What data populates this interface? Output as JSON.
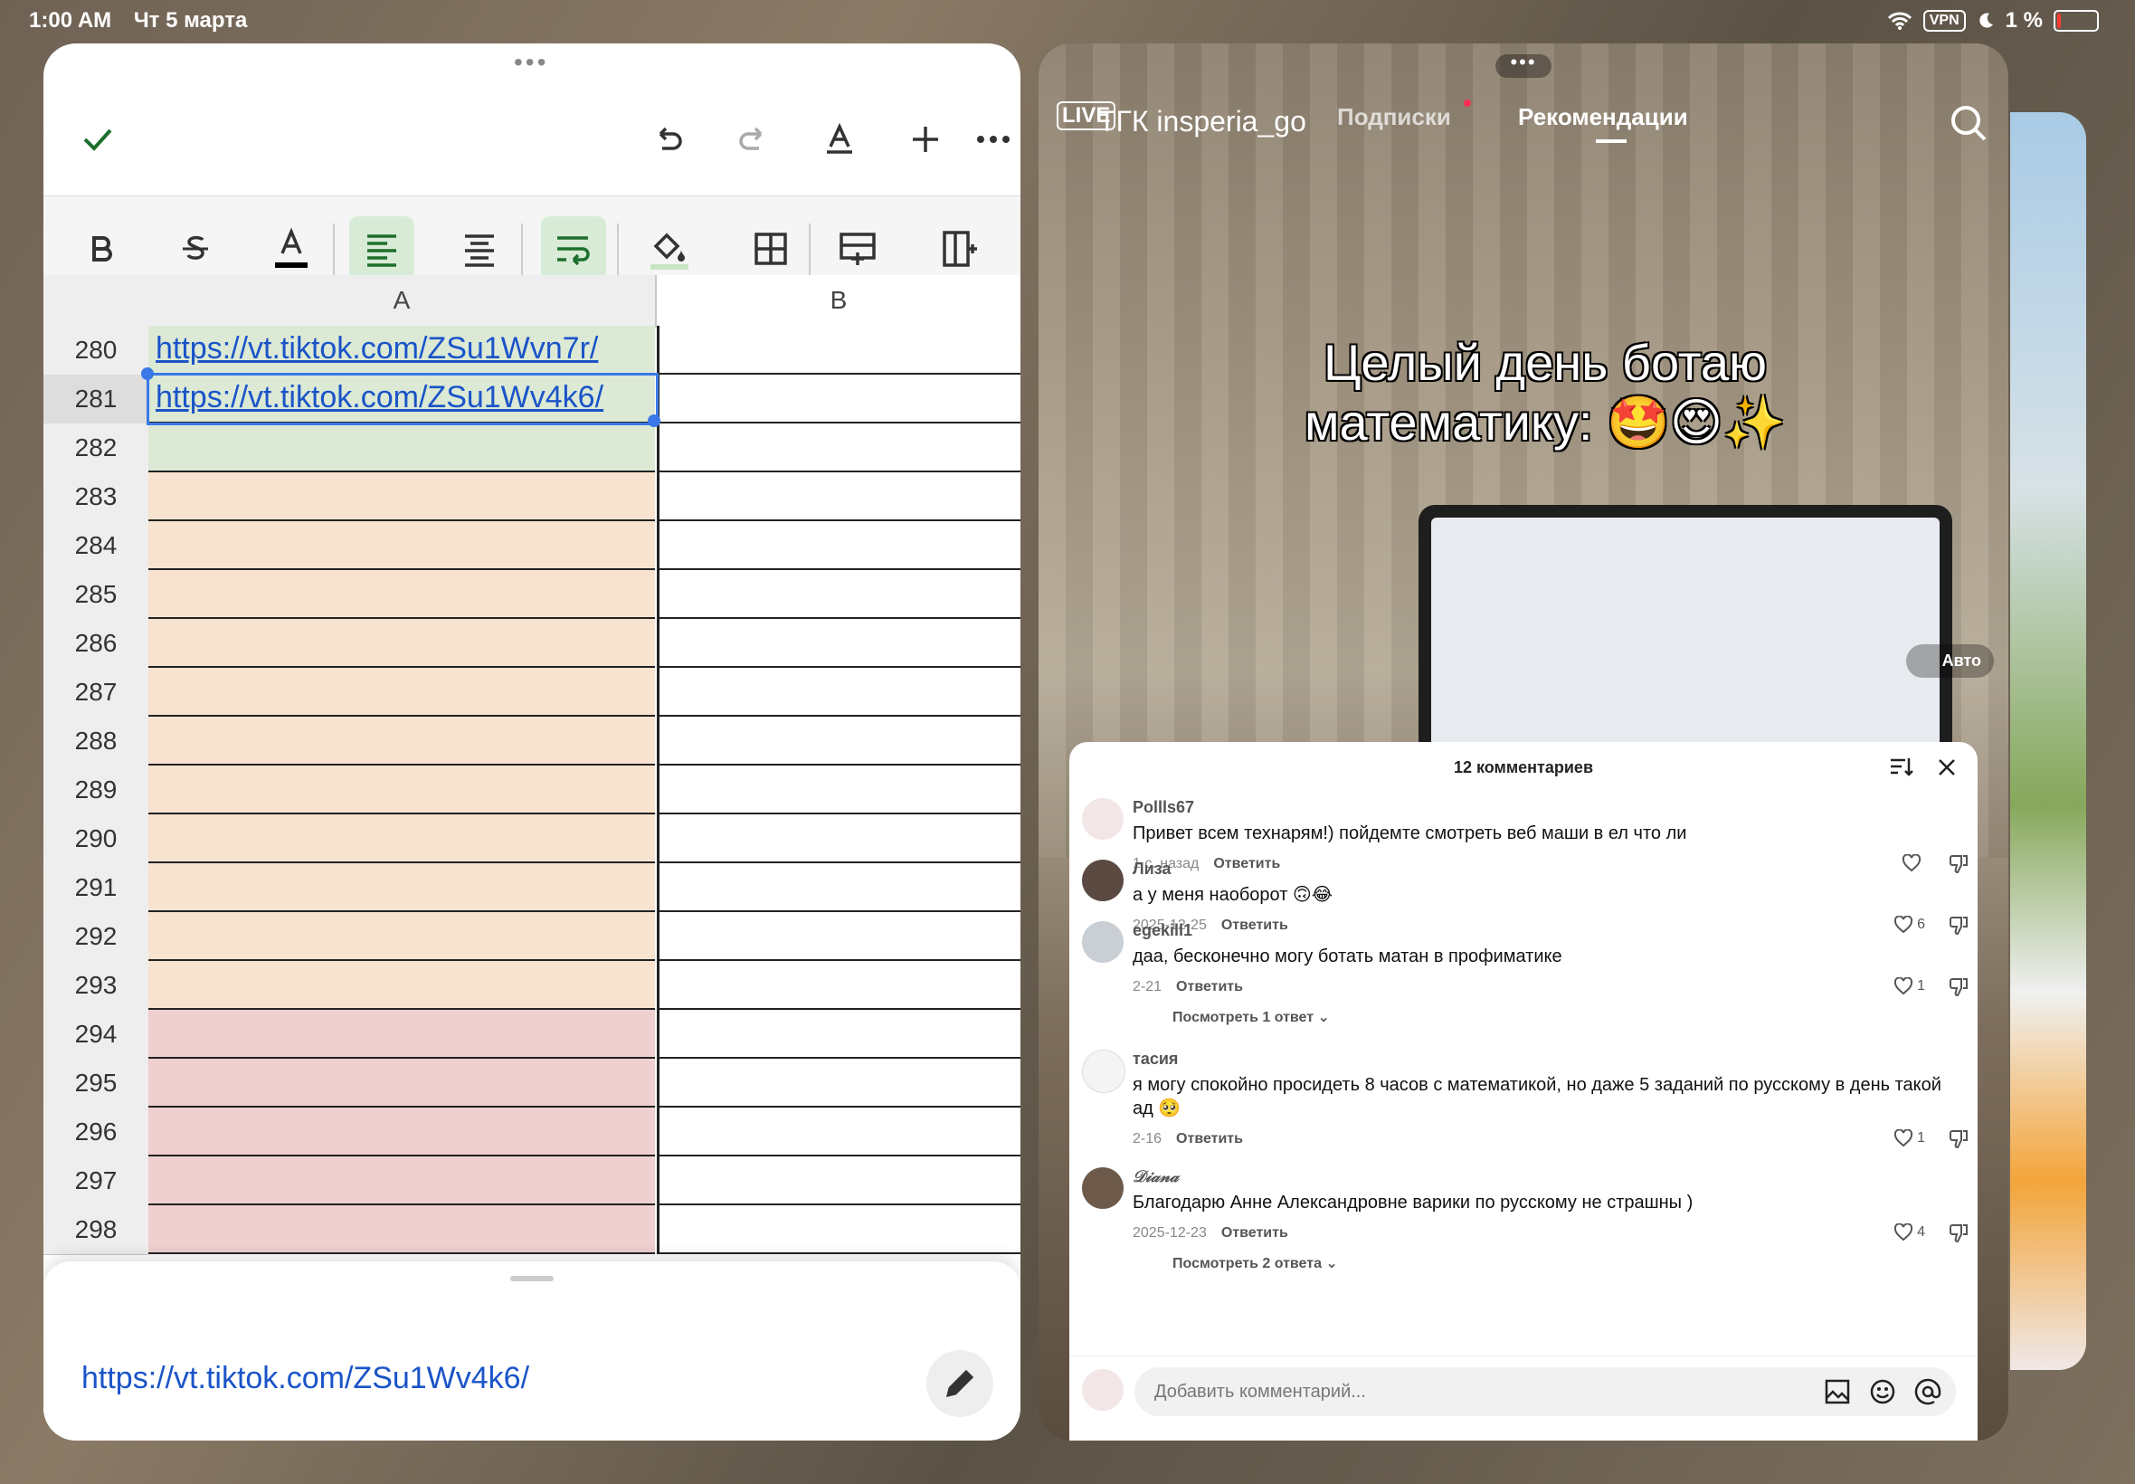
{
  "status": {
    "time": "1:00 AM",
    "date": "Чт 5 марта",
    "vpn": "VPN",
    "battery": "1 %"
  },
  "sheet": {
    "columns": [
      "A",
      "B"
    ],
    "rows": [
      {
        "num": "280",
        "a": "https://vt.tiktok.com/ZSu1Wvn7r/",
        "color": "green"
      },
      {
        "num": "281",
        "a": "https://vt.tiktok.com/ZSu1Wv4k6/",
        "color": "green"
      },
      {
        "num": "282",
        "a": "",
        "color": "green"
      },
      {
        "num": "283",
        "a": "",
        "color": "peach"
      },
      {
        "num": "284",
        "a": "",
        "color": "peach"
      },
      {
        "num": "285",
        "a": "",
        "color": "peach"
      },
      {
        "num": "286",
        "a": "",
        "color": "peach"
      },
      {
        "num": "287",
        "a": "",
        "color": "peach"
      },
      {
        "num": "288",
        "a": "",
        "color": "peach"
      },
      {
        "num": "289",
        "a": "",
        "color": "peach"
      },
      {
        "num": "290",
        "a": "",
        "color": "peach"
      },
      {
        "num": "291",
        "a": "",
        "color": "peach"
      },
      {
        "num": "292",
        "a": "",
        "color": "peach"
      },
      {
        "num": "293",
        "a": "",
        "color": "peach"
      },
      {
        "num": "294",
        "a": "",
        "color": "pink"
      },
      {
        "num": "295",
        "a": "",
        "color": "pink"
      },
      {
        "num": "296",
        "a": "",
        "color": "pink"
      },
      {
        "num": "297",
        "a": "",
        "color": "pink"
      },
      {
        "num": "298",
        "a": "",
        "color": "pink"
      }
    ],
    "cell_value": "https://vt.tiktok.com/ZSu1Wv4k6/"
  },
  "video": {
    "live": "LIVE",
    "channel": "ТГК insperia_go",
    "tab_following": "Подписки",
    "tab_foryou": "Рекомендации",
    "caption_line1": "Целый день ботаю",
    "caption_line2": "математику: 🤩😍✨",
    "auto": "Авто"
  },
  "comments": {
    "title": "12 комментариев",
    "items": [
      {
        "user": "Pollls67",
        "text": "Привет всем технарям!) пойдемте смотреть веб маши в ел что ли",
        "date": "1 с. назад",
        "reply": "Ответить",
        "likes": ""
      },
      {
        "user": "Лиза",
        "text": "а у меня наоборот 🙃😂",
        "date": "2025-12-25",
        "reply": "Ответить",
        "likes": "6"
      },
      {
        "user": "egekill1",
        "text": "даа, бесконечно могу ботать матан в профиматике",
        "date": "2-21",
        "reply": "Ответить",
        "likes": "1",
        "more": "Посмотреть 1 ответ"
      },
      {
        "user": "тасия",
        "text": "я могу спокойно просидеть 8 часов с математикой, но даже 5 заданий по русскому в день такой ад 🥺",
        "date": "2-16",
        "reply": "Ответить",
        "likes": "1"
      },
      {
        "user": "𝒟𝒾𝒶𝓃𝒶",
        "text": "Благодарю Анне Александровне варики по русскому не страшны )",
        "date": "2025-12-23",
        "reply": "Ответить",
        "likes": "4",
        "more": "Посмотреть 2 ответа"
      }
    ],
    "placeholder": "Добавить комментарий..."
  }
}
